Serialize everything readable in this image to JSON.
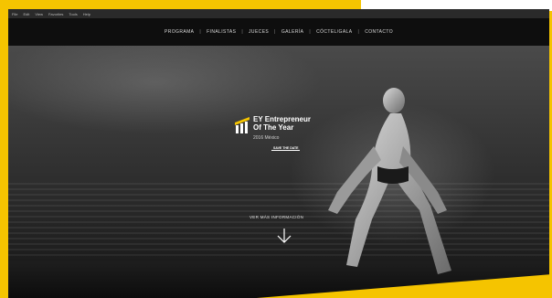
{
  "menubar": {
    "items": [
      "File",
      "Edit",
      "View",
      "Favorites",
      "Tools",
      "Help"
    ]
  },
  "nav": {
    "items": [
      "PROGRAMA",
      "FINALISTAS",
      "JUECES",
      "GALERÍA",
      "CÓCTEL/GALA",
      "CONTACTO"
    ]
  },
  "hero": {
    "title_line1": "EY Entrepreneur",
    "title_line2": "Of The Year",
    "subtitle": "2016 México",
    "tag": "SAVE THE DATE",
    "more_info": "VER MÁS INFORMACIÓN"
  },
  "colors": {
    "brand_yellow": "#f5c400",
    "nav_bg": "#0e0e0e",
    "text_light": "#d9d9d9"
  },
  "icons": {
    "logo": "ey-logo-icon",
    "arrow": "arrow-down-icon"
  }
}
